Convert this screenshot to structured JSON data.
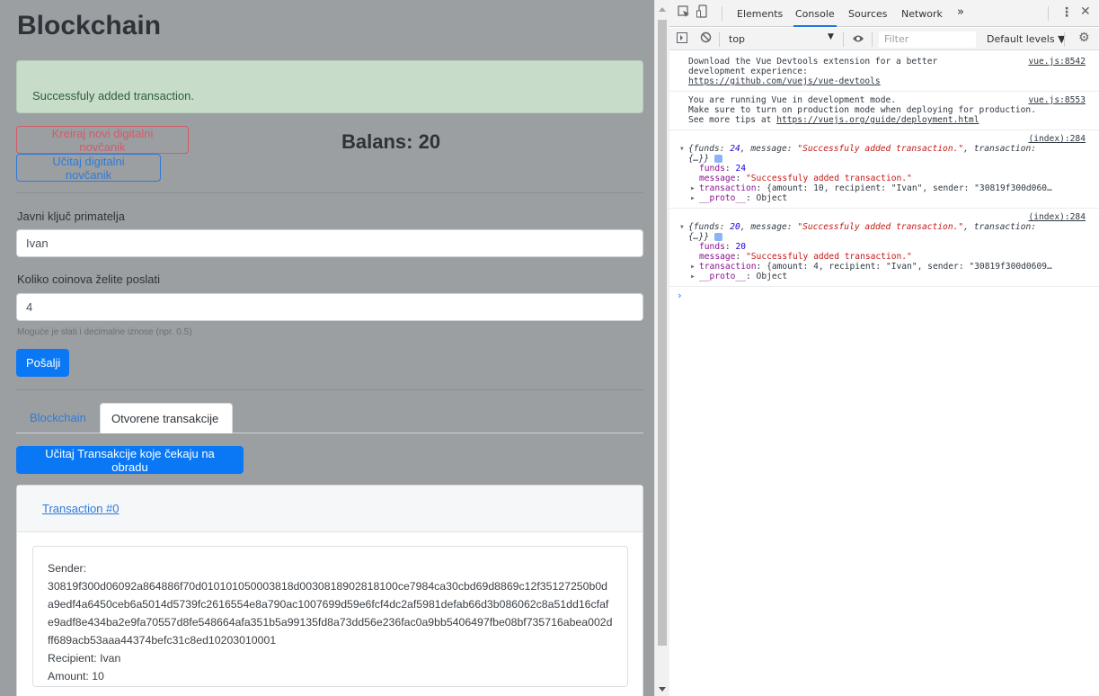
{
  "app": {
    "title": "Blockchain",
    "alert": "Successfuly added transaction.",
    "create_wallet": "Kreiraj novi digitalni novčanik",
    "load_wallet": "Učitaj digitalni novčanik",
    "balance": "Balans: 20",
    "recipient_label": "Javni ključ primatelja",
    "recipient_value": "Ivan",
    "amount_label": "Koliko coinova želite poslati",
    "amount_value": "4",
    "amount_hint": "Moguće je slati i decimalne iznose (npr. 0.5)",
    "send_button": "Pošalji",
    "tabs": [
      {
        "label": "Blockchain",
        "active": false
      },
      {
        "label": "Otvorene transakcije",
        "active": true
      }
    ],
    "load_pending_button": "Učitaj Transakcije koje čekaju na obradu",
    "transaction": {
      "header": "Transaction #0",
      "sender_label": "Sender:",
      "sender": "30819f300d06092a864886f70d010101050003818d0030818902818100ce7984ca30cbd69d8869c12f35127250b0da9edf4a6450ceb6a5014d5739fc2616554e8a790ac1007699d59e6fcf4dc2af5981defab66d3b086062c8a51dd16cfafe9adf8e434ba2e9fa70557d8fe548664afa351b5a99135fd8a73dd56e236fac0a9bb5406497fbe08bf735716abea002dff689acb53aaa44374befc31c8ed10203010001",
      "recipient": "Recipient: Ivan",
      "amount": "Amount: 10"
    }
  },
  "devtools": {
    "tabs": [
      "Elements",
      "Console",
      "Sources",
      "Network"
    ],
    "more": "»",
    "context": "top",
    "filter_placeholder": "Filter",
    "levels": "Default levels ▼",
    "messages": {
      "m1_line1": "Download the Vue Devtools extension for a better",
      "m1_line2": "development experience:",
      "m1_link": "https://github.com/vuejs/vue-devtools",
      "m1_src": "vue.js:8542",
      "m2_line1": "You are running Vue in development mode.",
      "m2_line2": "Make sure to turn on production mode when deploying for production.",
      "m2_line3": "See more tips at ",
      "m2_link": "https://vuejs.org/guide/deployment.html",
      "m2_src": "vue.js:8553",
      "log_src": "(index):284",
      "log1_funds": "24",
      "log1_tx": "{amount: 10, recipient: \"Ivan\", sender: \"30819f300d060…",
      "log2_funds": "20",
      "log2_tx": "{amount: 4, recipient: \"Ivan\", sender: \"30819f300d0609…",
      "message_value": "\"Successfuly added transaction.\"",
      "proto": "Object"
    }
  }
}
